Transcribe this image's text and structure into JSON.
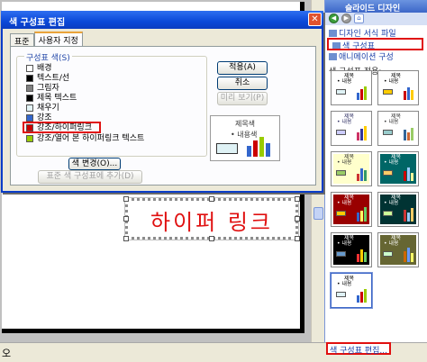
{
  "dialog": {
    "title": "색 구성표 편집",
    "close_glyph": "✕",
    "tabs": [
      {
        "label": "표준",
        "active": false
      },
      {
        "label": "사용자 지정",
        "active": true
      }
    ],
    "group_label": "구성표 색(S)",
    "colors": [
      {
        "label": "배경",
        "swatch": "#ffffff"
      },
      {
        "label": "텍스트/선",
        "swatch": "#000000"
      },
      {
        "label": "그림자",
        "swatch": "#808080"
      },
      {
        "label": "제목 텍스트",
        "swatch": "#000000"
      },
      {
        "label": "채우기",
        "swatch": "#e3f4f6"
      },
      {
        "label": "강조",
        "swatch": "#3366cc"
      },
      {
        "label": "강조/하이퍼링크",
        "swatch": "#cc0000"
      },
      {
        "label": "강조/열어 본 하이퍼링크 텍스트",
        "swatch": "#99cc00"
      }
    ],
    "change_color_button": "색 변경(O)...",
    "add_standard_button": "표준 색 구성표에 추가(D)",
    "apply_button": "적용(A)",
    "cancel_button": "취소",
    "preview_button": "미리 보기(P)",
    "preview": {
      "title": "제목색",
      "bullet": "• 내용색"
    }
  },
  "slide": {
    "text": "하이퍼 링크"
  },
  "task_pane": {
    "title": "슬라이드 디자인",
    "links": [
      {
        "label": "디자인 서식 파일",
        "selected": false
      },
      {
        "label": "색 구성표",
        "selected": true
      },
      {
        "label": "애니메이션 구성",
        "selected": false
      }
    ],
    "section_label": "색 구성표 적용:",
    "bottom_link": "색 구성표 편집...",
    "schemes": [
      {
        "bg": "#ffffff",
        "text": "#000000",
        "fill": "#dff2f5",
        "bars": [
          "#3366cc",
          "#cc0000",
          "#99cc00"
        ]
      },
      {
        "bg": "#ffffff",
        "text": "#000000",
        "fill": "#ffcc00",
        "bars": [
          "#cc0000",
          "#3366cc",
          "#ffcc00"
        ]
      },
      {
        "bg": "#ffffff",
        "text": "#333366",
        "fill": "#ccccff",
        "bars": [
          "#cc3366",
          "#333399",
          "#ffcc00"
        ]
      },
      {
        "bg": "#ffffff",
        "text": "#333333",
        "fill": "#99cccc",
        "bars": [
          "#336699",
          "#cc6633",
          "#99cc66"
        ]
      },
      {
        "bg": "#ffffcc",
        "text": "#333333",
        "fill": "#99cc66",
        "bars": [
          "#cc3333",
          "#3366cc",
          "#339966"
        ]
      },
      {
        "bg": "#006666",
        "text": "#ffffff",
        "fill": "#ffcc66",
        "bars": [
          "#cc0000",
          "#99ccff",
          "#ffff99"
        ]
      },
      {
        "bg": "#990000",
        "text": "#ffffff",
        "fill": "#ffcc00",
        "bars": [
          "#3366cc",
          "#ffff66",
          "#66cc66"
        ]
      },
      {
        "bg": "#003333",
        "text": "#ffffff",
        "fill": "#ccff99",
        "bars": [
          "#cc3333",
          "#99ccff",
          "#ffcc66"
        ]
      },
      {
        "bg": "#000000",
        "text": "#ffffff",
        "fill": "#6699cc",
        "bars": [
          "#ff3333",
          "#ffcc00",
          "#66cc66"
        ]
      },
      {
        "bg": "#666633",
        "text": "#ffffff",
        "fill": "#ccffcc",
        "bars": [
          "#cc6600",
          "#6699ff",
          "#ffff66"
        ]
      },
      {
        "bg": "#ffffff",
        "text": "#000000",
        "fill": "#dff2f5",
        "bars": [
          "#3366cc",
          "#cc0000",
          "#99cc00"
        ]
      }
    ],
    "scheme_title": "제목",
    "scheme_body": "• 내용"
  },
  "status_bar": {
    "text": "오"
  }
}
